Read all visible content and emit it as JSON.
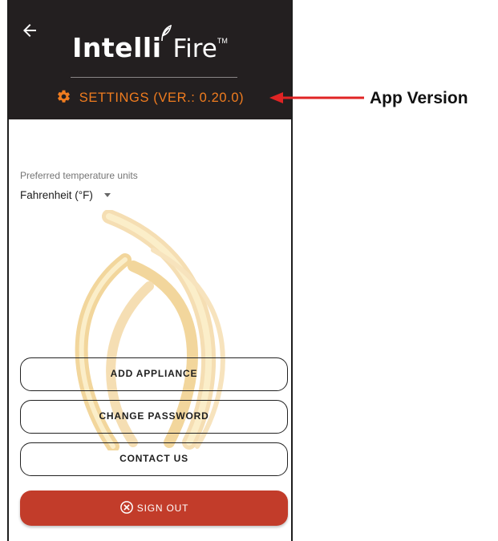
{
  "header": {
    "logo": {
      "bold": "Intelli",
      "light": "Fire",
      "trademark": "TM"
    },
    "settings_label": "SETTINGS (VER.: 0.20.0)"
  },
  "settings": {
    "temperature_label": "Preferred temperature units",
    "temperature_value": "Fahrenheit (°F)"
  },
  "buttons": {
    "add_appliance": "ADD APPLIANCE",
    "change_password": "CHANGE PASSWORD",
    "contact_us": "CONTACT US",
    "sign_out": "SIGN OUT"
  },
  "annotation": {
    "label": "App Version"
  },
  "colors": {
    "header_bg": "#231f20",
    "accent_orange": "#f07c1f",
    "sign_out_red": "#c23c2a",
    "annotation_arrow": "#e02424"
  },
  "icons": [
    "back-arrow-icon",
    "leaf-icon",
    "gear-icon",
    "chevron-down-icon",
    "flame-watermark-icon",
    "x-circle-icon"
  ]
}
